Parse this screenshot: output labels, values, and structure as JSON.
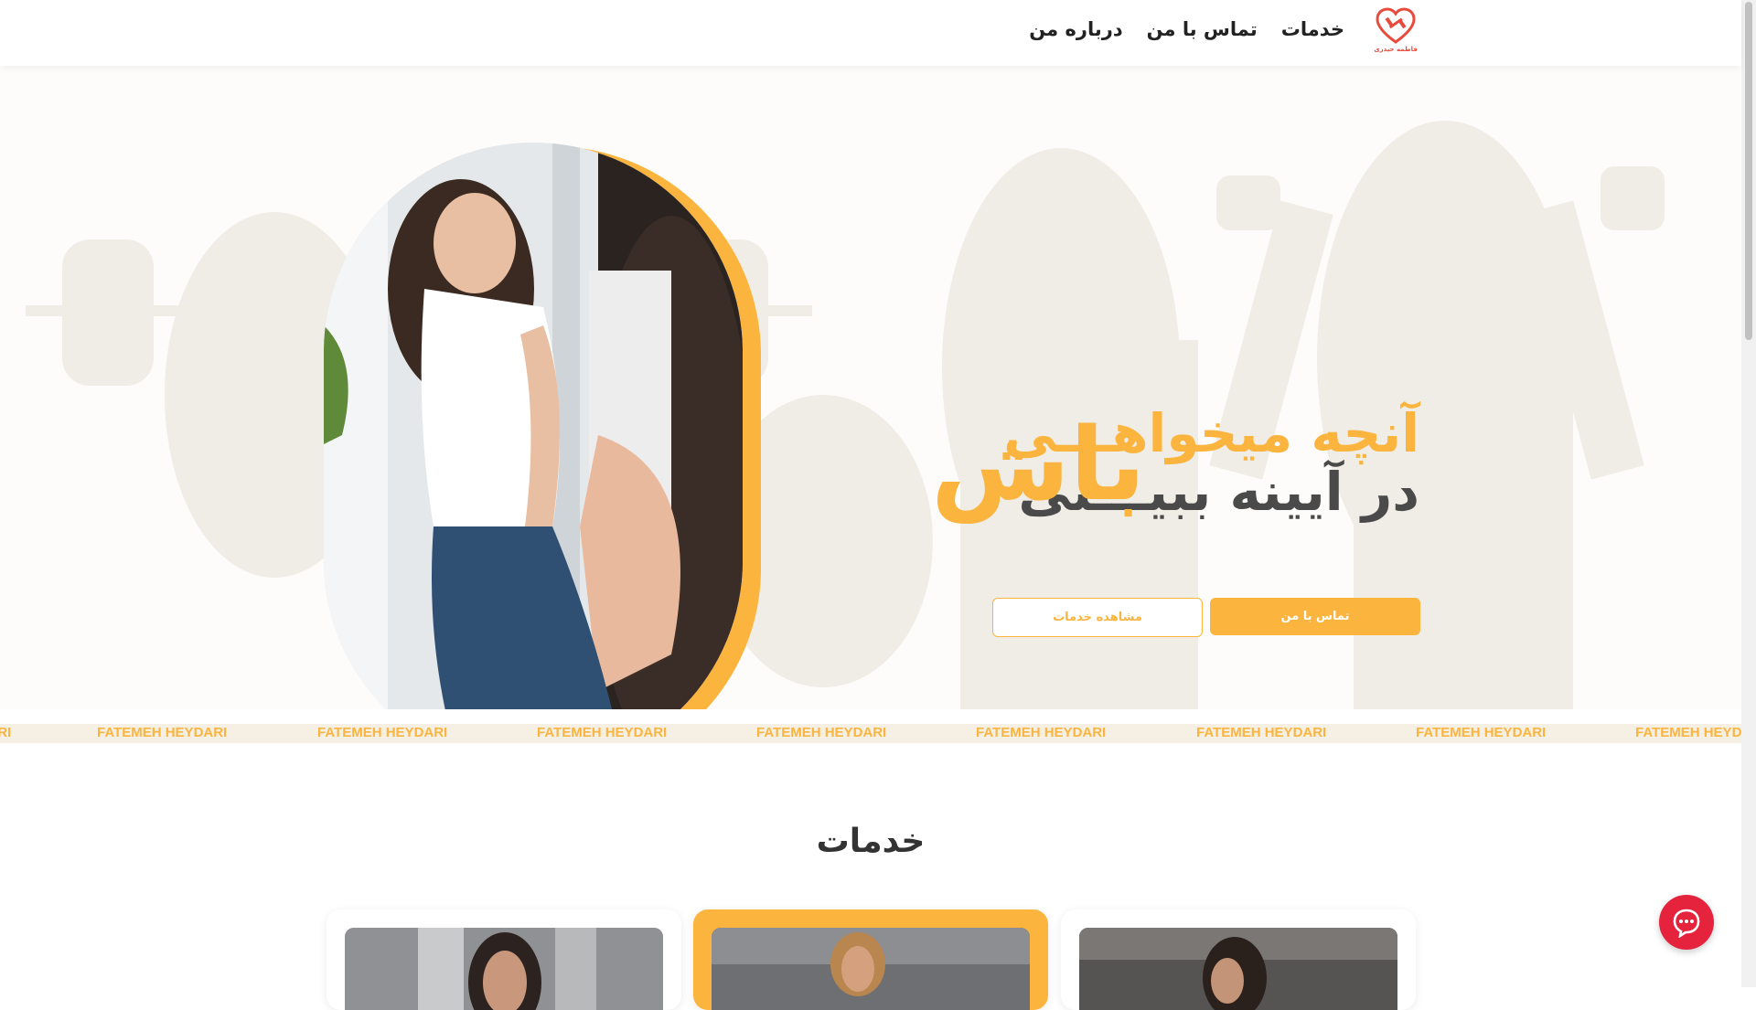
{
  "header": {
    "logo_text": "فاطمه حیدری",
    "nav": [
      {
        "label": "خدمات"
      },
      {
        "label": "تماس با من"
      },
      {
        "label": "درباره من"
      }
    ]
  },
  "hero": {
    "headline_line1": "آنچه میخواهـــی",
    "headline_line2": "در آیینه ببیـــنی",
    "headline_big": "باش",
    "btn_contact": "تماس با من",
    "btn_services": "مشاهده خدمات"
  },
  "marquee": {
    "text": "FATEMEH HEYDARI"
  },
  "services": {
    "title": "خدمات"
  },
  "colors": {
    "accent": "#fbb43e",
    "chat": "#e5233d",
    "text_dark": "#4a4a4a"
  }
}
